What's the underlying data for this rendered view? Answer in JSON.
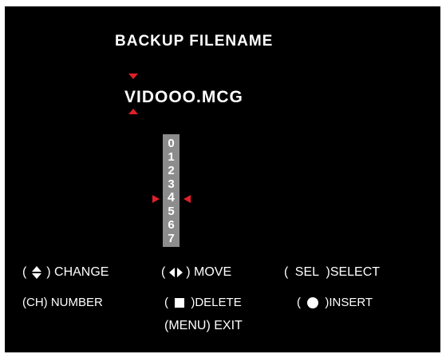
{
  "colors": {
    "background": "#000000",
    "text": "#ffffff",
    "accent": "#e0202a",
    "digit_column": "#8c8c8c"
  },
  "title": "BACKUP FILENAME",
  "filename": "VIDOOO.MCG",
  "digits": [
    "0",
    "1",
    "2",
    "3",
    "4",
    "5",
    "6",
    "7"
  ],
  "selected_digit": "4",
  "help": {
    "change": "CHANGE",
    "move": "MOVE",
    "select_key": "SEL",
    "select": "SELECT",
    "number_key": "CH",
    "number": "NUMBER",
    "delete": "DELETE",
    "insert": "INSERT",
    "menu_key": "MENU",
    "exit": "EXIT",
    "open_paren": "(",
    "close_paren": ")"
  }
}
